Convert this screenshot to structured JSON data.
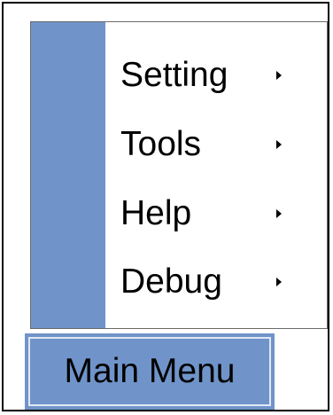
{
  "menu": {
    "items": [
      {
        "label": "Setting",
        "icon": "chevron-right-icon",
        "has_submenu": true
      },
      {
        "label": "Tools",
        "icon": "chevron-right-icon",
        "has_submenu": true
      },
      {
        "label": "Help",
        "icon": "chevron-right-icon",
        "has_submenu": true
      },
      {
        "label": "Debug",
        "icon": "chevron-right-icon",
        "has_submenu": true
      }
    ]
  },
  "main_button": {
    "label": "Main Menu"
  },
  "colors": {
    "accent": "#7094c9",
    "panel_background": "#ffffff",
    "text": "#000000",
    "inner_border": "#dfe8f5"
  }
}
